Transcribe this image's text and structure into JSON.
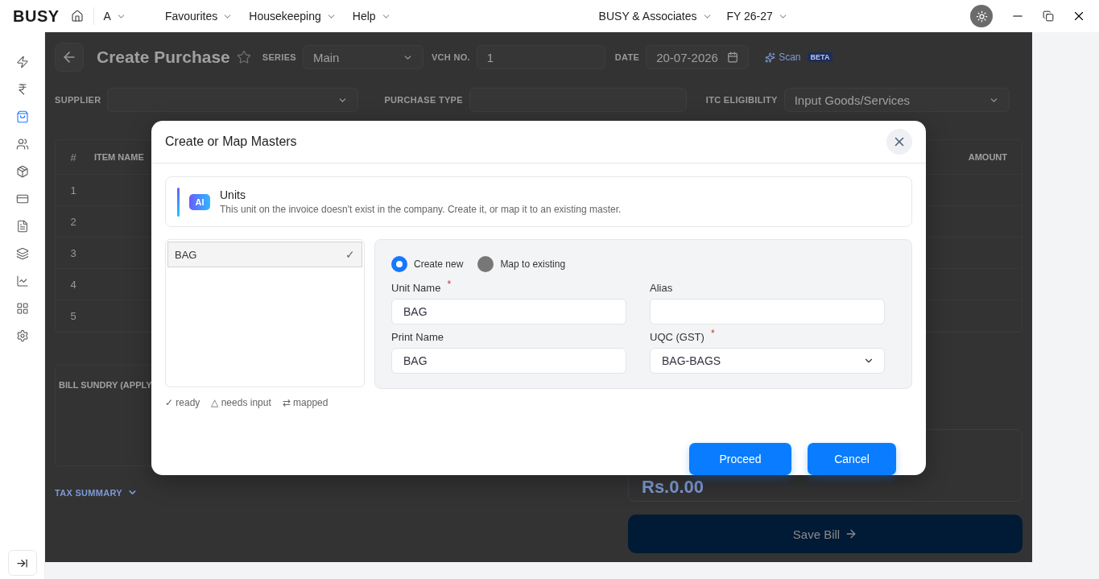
{
  "topbar": {
    "logo": "BUSY",
    "company_short": "A",
    "menus": [
      {
        "label": "Favourites"
      },
      {
        "label": "Housekeeping"
      },
      {
        "label": "Help"
      }
    ],
    "company": "BUSY & Associates",
    "fiscal_year": "FY 26-27"
  },
  "sidebar": {
    "items": [
      {
        "kind": "flash",
        "selected": false
      },
      {
        "kind": "rupee",
        "selected": false
      },
      {
        "kind": "bag",
        "selected": true
      },
      {
        "kind": "users",
        "selected": false
      },
      {
        "kind": "box",
        "selected": false
      },
      {
        "kind": "card",
        "selected": false
      },
      {
        "kind": "doc",
        "selected": false
      },
      {
        "kind": "layers",
        "selected": false
      },
      {
        "kind": "chart",
        "selected": false
      },
      {
        "kind": "grid",
        "selected": false
      },
      {
        "kind": "settings",
        "selected": false
      }
    ]
  },
  "voucher": {
    "title": "Create Purchase",
    "series_label": "SERIES",
    "series": "Main",
    "vch_label": "VCH NO.",
    "vch_no": "1",
    "date_label": "DATE",
    "date": "20-07-2026",
    "scan": "Scan",
    "scan_badge": "BETA",
    "supplier_label": "SUPPLIER",
    "purchase_type_label": "PURCHASE TYPE",
    "itc_label": "ITC ELIGIBILITY",
    "itc": "Input Goods/Services"
  },
  "table": {
    "columns": [
      "#",
      "ITEM NAME",
      "AMOUNT"
    ],
    "rows": [
      "1",
      "2",
      "3",
      "4",
      "5"
    ]
  },
  "bill_sundry": {
    "title": "BILL SUNDRY (APPLY"
  },
  "tax_summary": "TAX SUMMARY",
  "total": "Rs.0.00",
  "save_button": "Save Bill",
  "dialog": {
    "title": "Create or Map Masters",
    "info": {
      "badge": "AI",
      "title": "Units",
      "text": "This unit on the invoice doesn't exist in the company. Create it, or map it to an existing master."
    },
    "masters": [
      {
        "name": "BAG",
        "mark": "✓",
        "selected": true
      }
    ],
    "modes": [
      {
        "label": "Create new",
        "selected": true
      },
      {
        "label": "Map to existing",
        "selected": false
      }
    ],
    "fields": [
      {
        "label": "Unit Name",
        "required_mark": "*",
        "value": "BAG",
        "kind": "text"
      },
      {
        "label": "Alias",
        "kind": "text"
      },
      {
        "label": "Print Name",
        "value": "BAG",
        "kind": "text"
      },
      {
        "label": "UQC (GST)",
        "required_mark": "*",
        "value": "BAG-BAGS",
        "kind": "select"
      }
    ],
    "legend": [
      "✓ ready",
      "△ needs input",
      "⇄ mapped"
    ],
    "buttons": [
      "Proceed",
      "Cancel"
    ]
  }
}
